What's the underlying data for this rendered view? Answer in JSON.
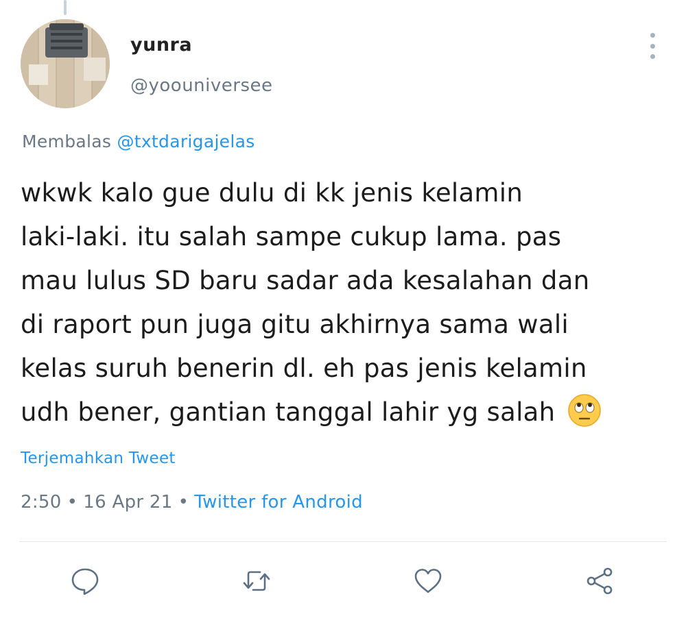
{
  "tweet": {
    "display_name": "yunra",
    "handle": "@yoouniversee",
    "reply_prefix": "Membalas",
    "reply_to": "@txtdarigajelas",
    "text_lines": [
      "wkwk kalo gue dulu di kk jenis kelamin",
      "laki-laki. itu salah sampe cukup lama. pas",
      "mau lulus SD baru sadar ada kesalahan dan",
      "di raport pun juga gitu akhirnya sama wali",
      "kelas suruh benerin dl. eh pas jenis kelamin",
      "udh bener, gantian tanggal lahir yg salah"
    ],
    "emoji": "face-with-rolling-eyes",
    "translate_label": "Terjemahkan Tweet",
    "time": "2:50",
    "separator": "•",
    "date": "16 Apr 21",
    "source": "Twitter for Android"
  },
  "actions": {
    "icons": [
      "reply-icon",
      "retweet-icon",
      "like-icon",
      "share-icon"
    ]
  },
  "colors": {
    "link": "#2795e9",
    "secondary_text": "#6a7885",
    "icon": "#5b7083",
    "text": "#1c1c1c"
  }
}
